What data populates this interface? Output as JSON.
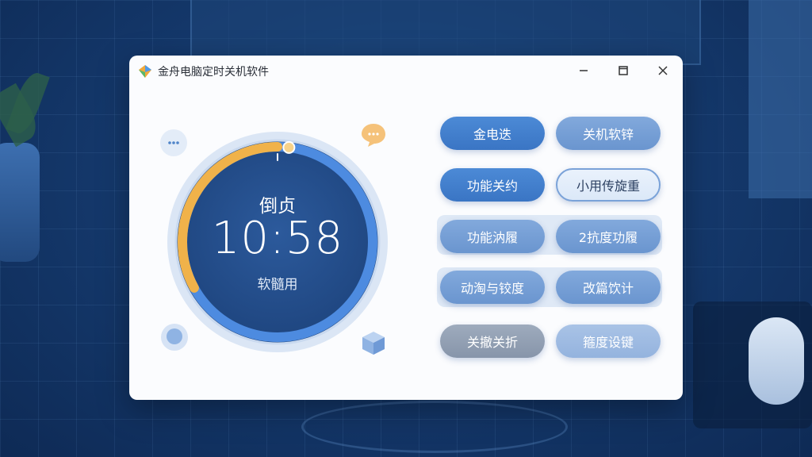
{
  "window": {
    "title": "金舟电脑定时关机软件"
  },
  "timer": {
    "label": "倒贞",
    "time": "10:58",
    "sub_label": "软髓用",
    "progress": 0.33
  },
  "buttons": [
    {
      "label": "金电迭",
      "style": "primary"
    },
    {
      "label": "关机软锌",
      "style": "soft"
    },
    {
      "label": "功能关约",
      "style": "primary"
    },
    {
      "label": "小用传旋重",
      "style": "light"
    },
    {
      "label": "功能汭履",
      "style": "soft"
    },
    {
      "label": "2抗度功履",
      "style": "soft"
    },
    {
      "label": "动淘与铰度",
      "style": "soft"
    },
    {
      "label": "改篇饮计",
      "style": "soft"
    },
    {
      "label": "关撤关折",
      "style": "gray"
    },
    {
      "label": "箍度设键",
      "style": "paleblue"
    }
  ],
  "colors": {
    "accent": "#3a75c4",
    "ring_progress": "#f0b24a",
    "ring_track": "#4d8be0",
    "dial_fill": "#23508f"
  }
}
